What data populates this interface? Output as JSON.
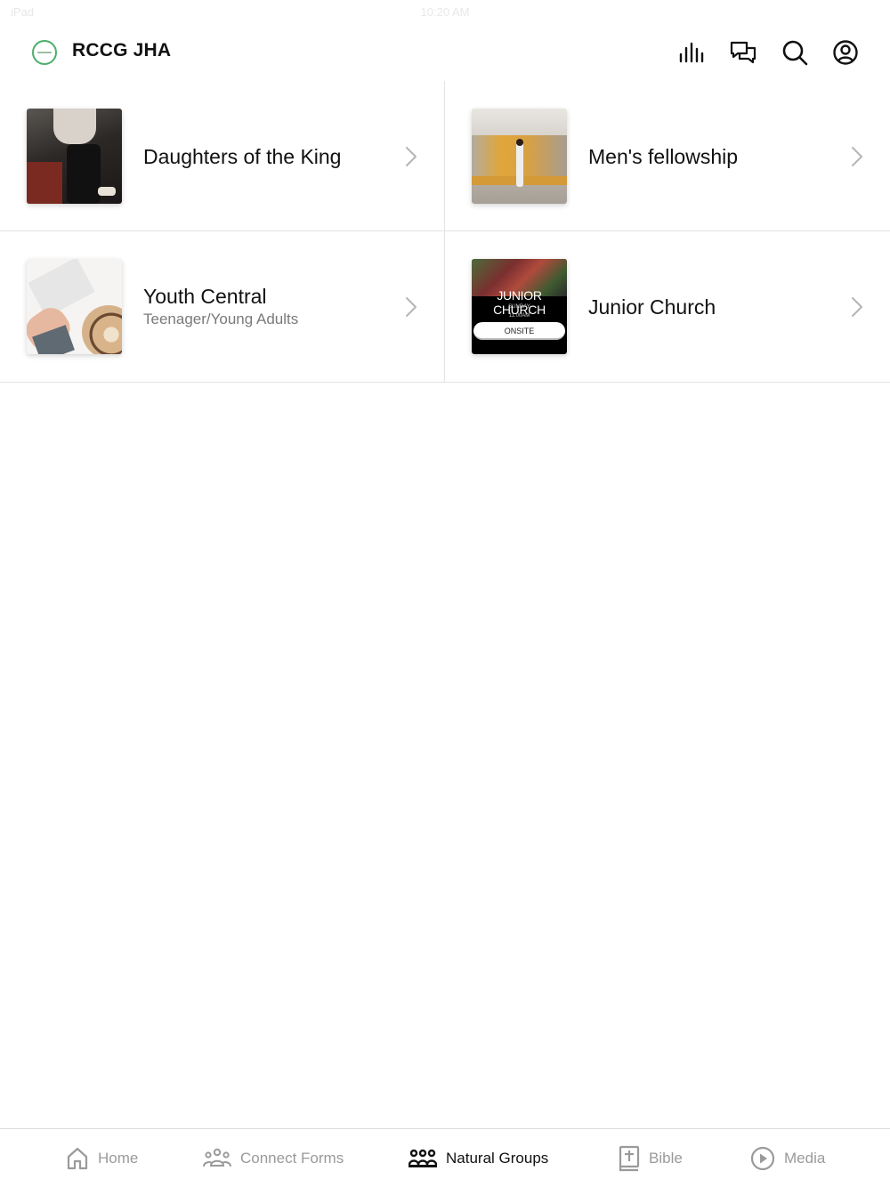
{
  "status_bar": {
    "carrier": "iPad",
    "time": "10:20 AM"
  },
  "header": {
    "title": "RCCG JHA",
    "icons": [
      "bar-chart-icon",
      "chat-icon",
      "search-icon",
      "account-icon"
    ]
  },
  "groups": [
    {
      "title": "Daughters of the King",
      "subtitle": ""
    },
    {
      "title": "Men's fellowship",
      "subtitle": ""
    },
    {
      "title": "Youth Central",
      "subtitle": "Teenager/Young Adults"
    },
    {
      "title": "Junior Church",
      "subtitle": ""
    }
  ],
  "junior_thumb": {
    "title": "JUNIOR CHURCH",
    "day": "SUNDAY",
    "time": "11:00AM",
    "badge": "ONSITE"
  },
  "tabs": [
    {
      "label": "Home",
      "icon": "home-icon",
      "active": false
    },
    {
      "label": "Connect Forms",
      "icon": "people-icon",
      "active": false
    },
    {
      "label": "Natural Groups",
      "icon": "groups-icon",
      "active": true
    },
    {
      "label": "Bible",
      "icon": "bible-icon",
      "active": false
    },
    {
      "label": "Media",
      "icon": "play-icon",
      "active": false
    }
  ],
  "colors": {
    "accent": "#111111",
    "inactive": "#9a9a9a",
    "divider": "#e3e3e3",
    "logo_ring": "#4caf6a"
  }
}
